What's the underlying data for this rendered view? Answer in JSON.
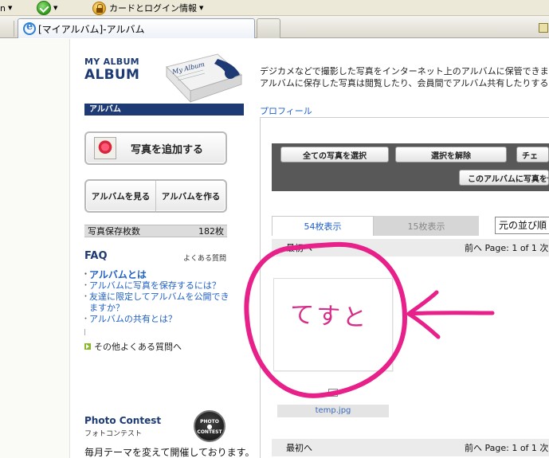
{
  "browser": {
    "toolbar": {
      "left_label": "n",
      "card_login_label": "カードとログイン情報"
    },
    "tab": {
      "title": "[マイアルバム]-アルバム"
    }
  },
  "sidebar": {
    "brand_small": "MY ALBUM",
    "brand_big": "ALBUM",
    "album_art_label": "My Album",
    "section_label": "アルバム",
    "add_photo_label": "写真を追加する",
    "view_album_label": "アルバムを見る",
    "create_album_label": "アルバムを作る",
    "photo_count_label": "写真保存枚数",
    "photo_count_value": "182枚",
    "faq": {
      "title": "FAQ",
      "subtitle": "よくある質問",
      "items": [
        "アルバムとは",
        "アルバムに写真を保存するには？",
        "友達に限定してアルバムを公開できますか？",
        "アルバムの共有とは？"
      ],
      "more_label": "その他よくある質問へ"
    },
    "contest": {
      "title": "Photo Contest",
      "subtitle": "フォトコンテスト",
      "badge_line1": "PHOTO",
      "badge_line2": "CONTEST",
      "description": "毎月テーマを変えて開催しております。"
    }
  },
  "main": {
    "intro_line1": "デジカメなどで撮影した写真をインターネット上のアルバムに保管できます",
    "intro_line2": "アルバムに保存した写真は閲覧したり、会員間でアルバム共有したりする",
    "profile_link": "プロフィール",
    "actions": {
      "select_all": "全ての写真を選択",
      "deselect": "選択を解除",
      "third": "チェ",
      "save_to_album": "このアルバムに写真を保"
    },
    "view_tabs": {
      "tab_54": "54枚表示",
      "tab_15": "15枚表示",
      "sort_selected": "元の並び順"
    },
    "pager": {
      "first": "最初へ",
      "info": "前へ Page: 1 of 1 次"
    },
    "photo": {
      "text": "てすと",
      "filename": "temp.jpg"
    }
  },
  "colors": {
    "brand_navy": "#1d3a74",
    "link_blue": "#2060c8",
    "annotation_pink": "#e8208a",
    "panel_gray": "#585858"
  }
}
